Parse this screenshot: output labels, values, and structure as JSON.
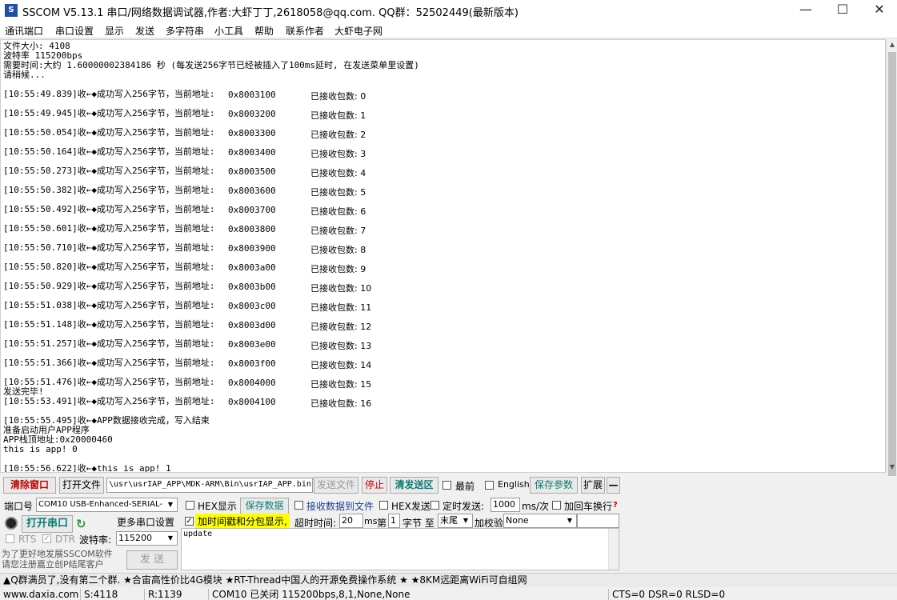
{
  "window": {
    "icon_text": "S",
    "title": "SSCOM V5.13.1 串口/网络数据调试器,作者:大虾丁丁,2618058@qq.com. QQ群：52502449(最新版本)",
    "min": "—",
    "max": "☐",
    "close": "✕"
  },
  "menu": [
    "通讯端口",
    "串口设置",
    "显示",
    "发送",
    "多字符串",
    "小工具",
    "帮助",
    "联系作者",
    "大虾电子网"
  ],
  "recv": {
    "header": [
      "文件大小: 4108",
      "波特率 115200bps",
      "需要时间:大约 1.60000002384186 秒 (每发送256字节已经被插入了100ms延时, 在发送菜单里设置)",
      "请稍候..."
    ],
    "rows": [
      {
        "ts": "[10:55:49.839]收←◆成功写入256字节，当前地址:",
        "addr": "0x8003100",
        "cnt": "已接收包数: 0"
      },
      {
        "ts": "[10:55:49.945]收←◆成功写入256字节，当前地址:",
        "addr": "0x8003200",
        "cnt": "已接收包数: 1"
      },
      {
        "ts": "[10:55:50.054]收←◆成功写入256字节，当前地址:",
        "addr": "0x8003300",
        "cnt": "已接收包数: 2"
      },
      {
        "ts": "[10:55:50.164]收←◆成功写入256字节，当前地址:",
        "addr": "0x8003400",
        "cnt": "已接收包数: 3"
      },
      {
        "ts": "[10:55:50.273]收←◆成功写入256字节，当前地址:",
        "addr": "0x8003500",
        "cnt": "已接收包数: 4"
      },
      {
        "ts": "[10:55:50.382]收←◆成功写入256字节，当前地址:",
        "addr": "0x8003600",
        "cnt": "已接收包数: 5"
      },
      {
        "ts": "[10:55:50.492]收←◆成功写入256字节，当前地址:",
        "addr": "0x8003700",
        "cnt": "已接收包数: 6"
      },
      {
        "ts": "[10:55:50.601]收←◆成功写入256字节，当前地址:",
        "addr": "0x8003800",
        "cnt": "已接收包数: 7"
      },
      {
        "ts": "[10:55:50.710]收←◆成功写入256字节，当前地址:",
        "addr": "0x8003900",
        "cnt": "已接收包数: 8"
      },
      {
        "ts": "[10:55:50.820]收←◆成功写入256字节，当前地址:",
        "addr": "0x8003a00",
        "cnt": "已接收包数: 9"
      },
      {
        "ts": "[10:55:50.929]收←◆成功写入256字节，当前地址:",
        "addr": "0x8003b00",
        "cnt": "已接收包数: 10"
      },
      {
        "ts": "[10:55:51.038]收←◆成功写入256字节，当前地址:",
        "addr": "0x8003c00",
        "cnt": "已接收包数: 11"
      },
      {
        "ts": "[10:55:51.148]收←◆成功写入256字节，当前地址:",
        "addr": "0x8003d00",
        "cnt": "已接收包数: 12"
      },
      {
        "ts": "[10:55:51.257]收←◆成功写入256字节，当前地址:",
        "addr": "0x8003e00",
        "cnt": "已接收包数: 13"
      },
      {
        "ts": "[10:55:51.366]收←◆成功写入256字节，当前地址:",
        "addr": "0x8003f00",
        "cnt": "已接收包数: 14"
      },
      {
        "ts": "[10:55:51.476]收←◆成功写入256字节，当前地址:",
        "addr": "0x8004000",
        "cnt": "已接收包数: 15"
      }
    ],
    "send_done": "发送完毕!",
    "last_row": {
      "ts": "[10:55:53.491]收←◆成功写入256字节，当前地址:",
      "addr": "0x8004100",
      "cnt": "已接收包数: 16"
    },
    "tail": [
      "[10:55:55.495]收←◆APP数据接收完成，写入结束",
      "准备启动用户APP程序",
      "APP栈顶地址:0x20000460",
      "this is app!    0"
    ],
    "final": "[10:55:56.622]收←◆this is app!        1"
  },
  "toolbar": {
    "clear_window": "清除窗口",
    "open_file": "打开文件",
    "file_path": "\\usr\\usrIAP_APP\\MDK-ARM\\Bin\\usrIAP_APP.bin",
    "send_file": "发送文件",
    "stop": "停止",
    "clear_send": "清发送区",
    "topmost": "最前",
    "english": "English",
    "save_params": "保存参数",
    "expand": "扩展",
    "collapse": "—"
  },
  "ctrl": {
    "port_label": "端口号",
    "port_value": "COM10 USB-Enhanced-SERIAL-",
    "hex_display": "HEX显示",
    "save_data": "保存数据",
    "recv_to_file": "接收数据到文件",
    "hex_send": "HEX发送",
    "timed_send": "定时发送:",
    "interval": "1000",
    "interval_unit": "ms/次",
    "add_crlf": "加回车换行",
    "open_port": "打开串口",
    "more_settings": "更多串口设置",
    "timestamp": "加时间戳和分包显示,",
    "timeout_label": "超时时间:",
    "timeout": "20",
    "ms": "ms",
    "nth": "第",
    "byte_no": "1",
    "byte_to": "字节 至",
    "tail_opt": "末尾",
    "checksum": "加校验",
    "checksum_value": "None",
    "rts": "RTS",
    "dtr": "DTR",
    "baud_label": "波特率:",
    "baud": "115200",
    "promo": "为了更好地发展SSCOM软件\n请您注册嘉立创P结尾客户",
    "send": "发 送",
    "send_text": "update"
  },
  "ad": "▲Q群满员了,没有第二个群. ★合宙高性价比4G模块 ★RT-Thread中国人的开源免费操作系统 ★ ★8KM远距离WiFi可自组网",
  "status": {
    "site": "www.daxia.com",
    "s": "S:4118",
    "r": "R:1139",
    "port": "COM10 已关闭  115200bps,8,1,None,None",
    "lines": "CTS=0 DSR=0 RLSD=0"
  }
}
